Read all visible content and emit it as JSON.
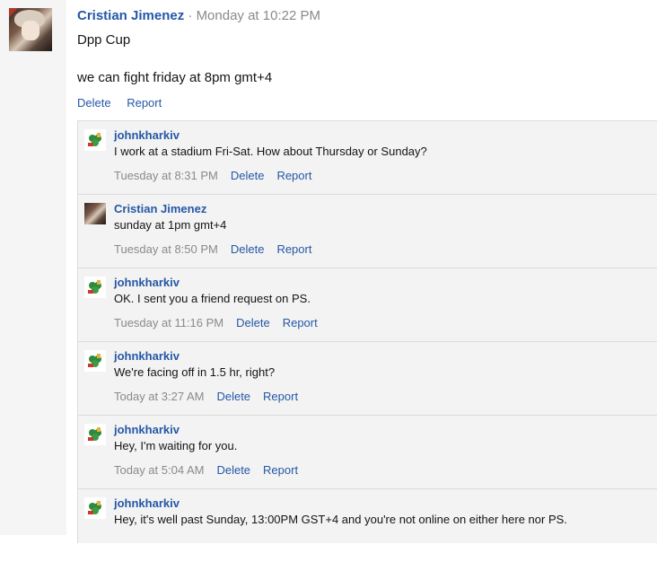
{
  "post": {
    "author": "Cristian Jimenez",
    "separator": " · ",
    "time": "Monday at 10:22 PM",
    "line1": "Dpp Cup",
    "line2": "we can fight friday at 8pm gmt+4",
    "delete_label": "Delete",
    "report_label": "Report"
  },
  "comments": [
    {
      "author": "johnkharkiv",
      "text": "I work at a stadium Fri-Sat. How about Thursday or Sunday?",
      "time": "Tuesday at 8:31 PM",
      "delete": "Delete",
      "report": "Report",
      "avatar": "clover-avatar-icon"
    },
    {
      "author": "Cristian Jimenez",
      "text": "sunday at 1pm gmt+4",
      "time": "Tuesday at 8:50 PM",
      "delete": "Delete",
      "report": "Report",
      "avatar": "photo-avatar"
    },
    {
      "author": "johnkharkiv",
      "text": "OK. I sent you a friend request on PS.",
      "time": "Tuesday at 11:16 PM",
      "delete": "Delete",
      "report": "Report",
      "avatar": "clover-avatar-icon"
    },
    {
      "author": "johnkharkiv",
      "text": "We're facing off in 1.5 hr, right?",
      "time": "Today at 3:27 AM",
      "delete": "Delete",
      "report": "Report",
      "avatar": "clover-avatar-icon"
    },
    {
      "author": "johnkharkiv",
      "text": "Hey, I'm waiting for you.",
      "time": "Today at 5:04 AM",
      "delete": "Delete",
      "report": "Report",
      "avatar": "clover-avatar-icon"
    },
    {
      "author": "johnkharkiv",
      "text": "Hey, it's well past Sunday, 13:00PM GST+4 and you're not online on either here nor PS.",
      "time": "",
      "delete": "",
      "report": "",
      "avatar": "clover-avatar-icon"
    }
  ],
  "colors": {
    "link": "#2557a7",
    "meta": "#8a8a8a",
    "panel": "#f3f3f3"
  }
}
